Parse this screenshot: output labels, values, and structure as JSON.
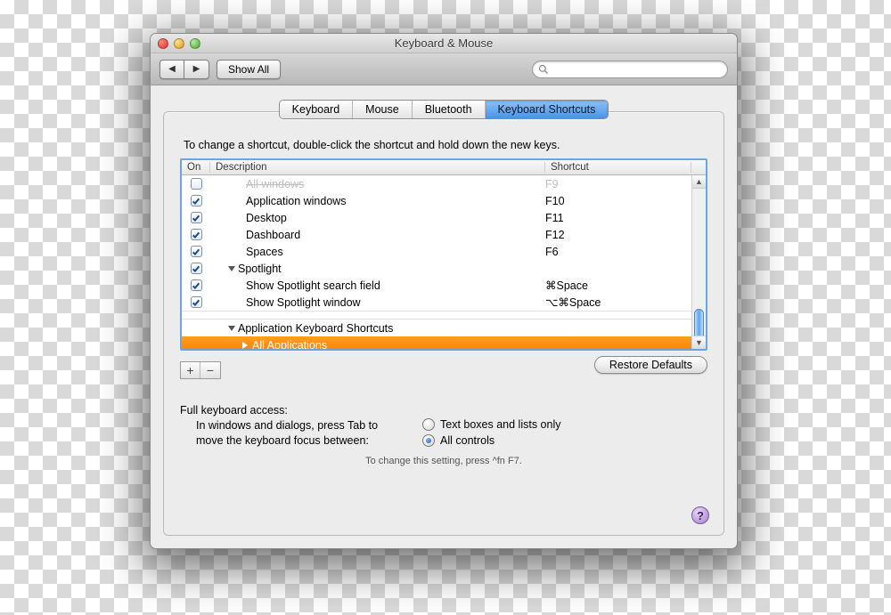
{
  "window": {
    "title": "Keyboard & Mouse"
  },
  "toolbar": {
    "show_all": "Show All",
    "search_placeholder": ""
  },
  "tabs": [
    {
      "label": "Keyboard",
      "active": false
    },
    {
      "label": "Mouse",
      "active": false
    },
    {
      "label": "Bluetooth",
      "active": false
    },
    {
      "label": "Keyboard Shortcuts",
      "active": true
    }
  ],
  "instruction": "To change a shortcut, double-click the shortcut and hold down the new keys.",
  "columns": {
    "on": "On",
    "desc": "Description",
    "shortcut": "Shortcut"
  },
  "rows": [
    {
      "on": false,
      "cut": true,
      "indent": 2,
      "desc": "All windows",
      "shortcut": "F9"
    },
    {
      "on": true,
      "indent": 2,
      "desc": "Application windows",
      "shortcut": "F10"
    },
    {
      "on": true,
      "indent": 2,
      "desc": "Desktop",
      "shortcut": "F11"
    },
    {
      "on": true,
      "indent": 2,
      "desc": "Dashboard",
      "shortcut": "F12"
    },
    {
      "on": true,
      "indent": 2,
      "desc": "Spaces",
      "shortcut": "F6"
    },
    {
      "on": true,
      "indent": 1,
      "disclosure": "down",
      "desc": "Spotlight",
      "shortcut": ""
    },
    {
      "on": true,
      "indent": 2,
      "desc": "Show Spotlight search field",
      "shortcut": "⌘Space"
    },
    {
      "on": true,
      "indent": 2,
      "desc": "Show Spotlight window",
      "shortcut": "⌥⌘Space"
    },
    {
      "gap": true
    },
    {
      "on": null,
      "indent": 1,
      "disclosure": "down",
      "desc": "Application Keyboard Shortcuts",
      "shortcut": ""
    },
    {
      "on": null,
      "indent": 2,
      "disclosure": "right",
      "desc": "All Applications",
      "shortcut": "",
      "selected": true
    }
  ],
  "buttons": {
    "add": "+",
    "remove": "−",
    "restore": "Restore Defaults"
  },
  "fka": {
    "title": "Full keyboard access:",
    "explain1": "In windows and dialogs, press Tab to",
    "explain2": "move the keyboard focus between:",
    "opt1": "Text boxes and lists only",
    "opt2": "All controls",
    "hint": "To change this setting, press ^fn F7."
  },
  "help": "?"
}
